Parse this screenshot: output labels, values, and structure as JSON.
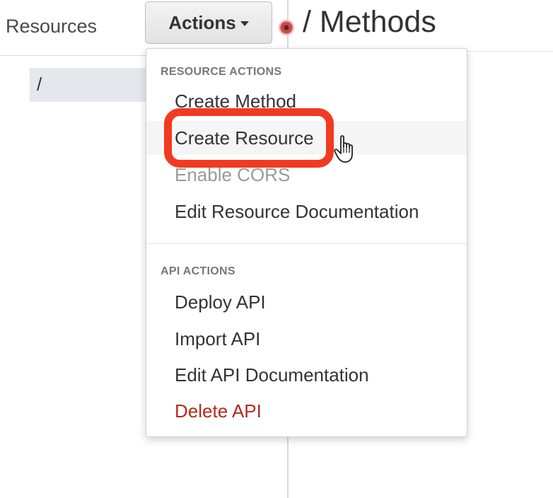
{
  "sidebar": {
    "title": "Resources",
    "tree": [
      {
        "label": "/"
      }
    ]
  },
  "toolbar": {
    "actions_label": "Actions",
    "caret_icon": "chevron-down-icon",
    "loading_icon": "spinner-icon"
  },
  "main": {
    "title": "/ Methods"
  },
  "dropdown": {
    "resource_actions": {
      "header": "RESOURCE ACTIONS",
      "items": [
        {
          "label": "Create Method"
        },
        {
          "label": "Create Resource"
        },
        {
          "label": "Enable CORS"
        },
        {
          "label": "Edit Resource Documentation"
        }
      ]
    },
    "api_actions": {
      "header": "API ACTIONS",
      "items": [
        {
          "label": "Deploy API"
        },
        {
          "label": "Import API"
        },
        {
          "label": "Edit API Documentation"
        },
        {
          "label": "Delete API"
        }
      ]
    }
  },
  "colors": {
    "highlight": "#f23a22",
    "danger": "#b52a1c",
    "disabled": "#9a9a9a",
    "selected_bg": "#e4e8ec"
  },
  "cursor_icon": "hand-pointer-icon"
}
